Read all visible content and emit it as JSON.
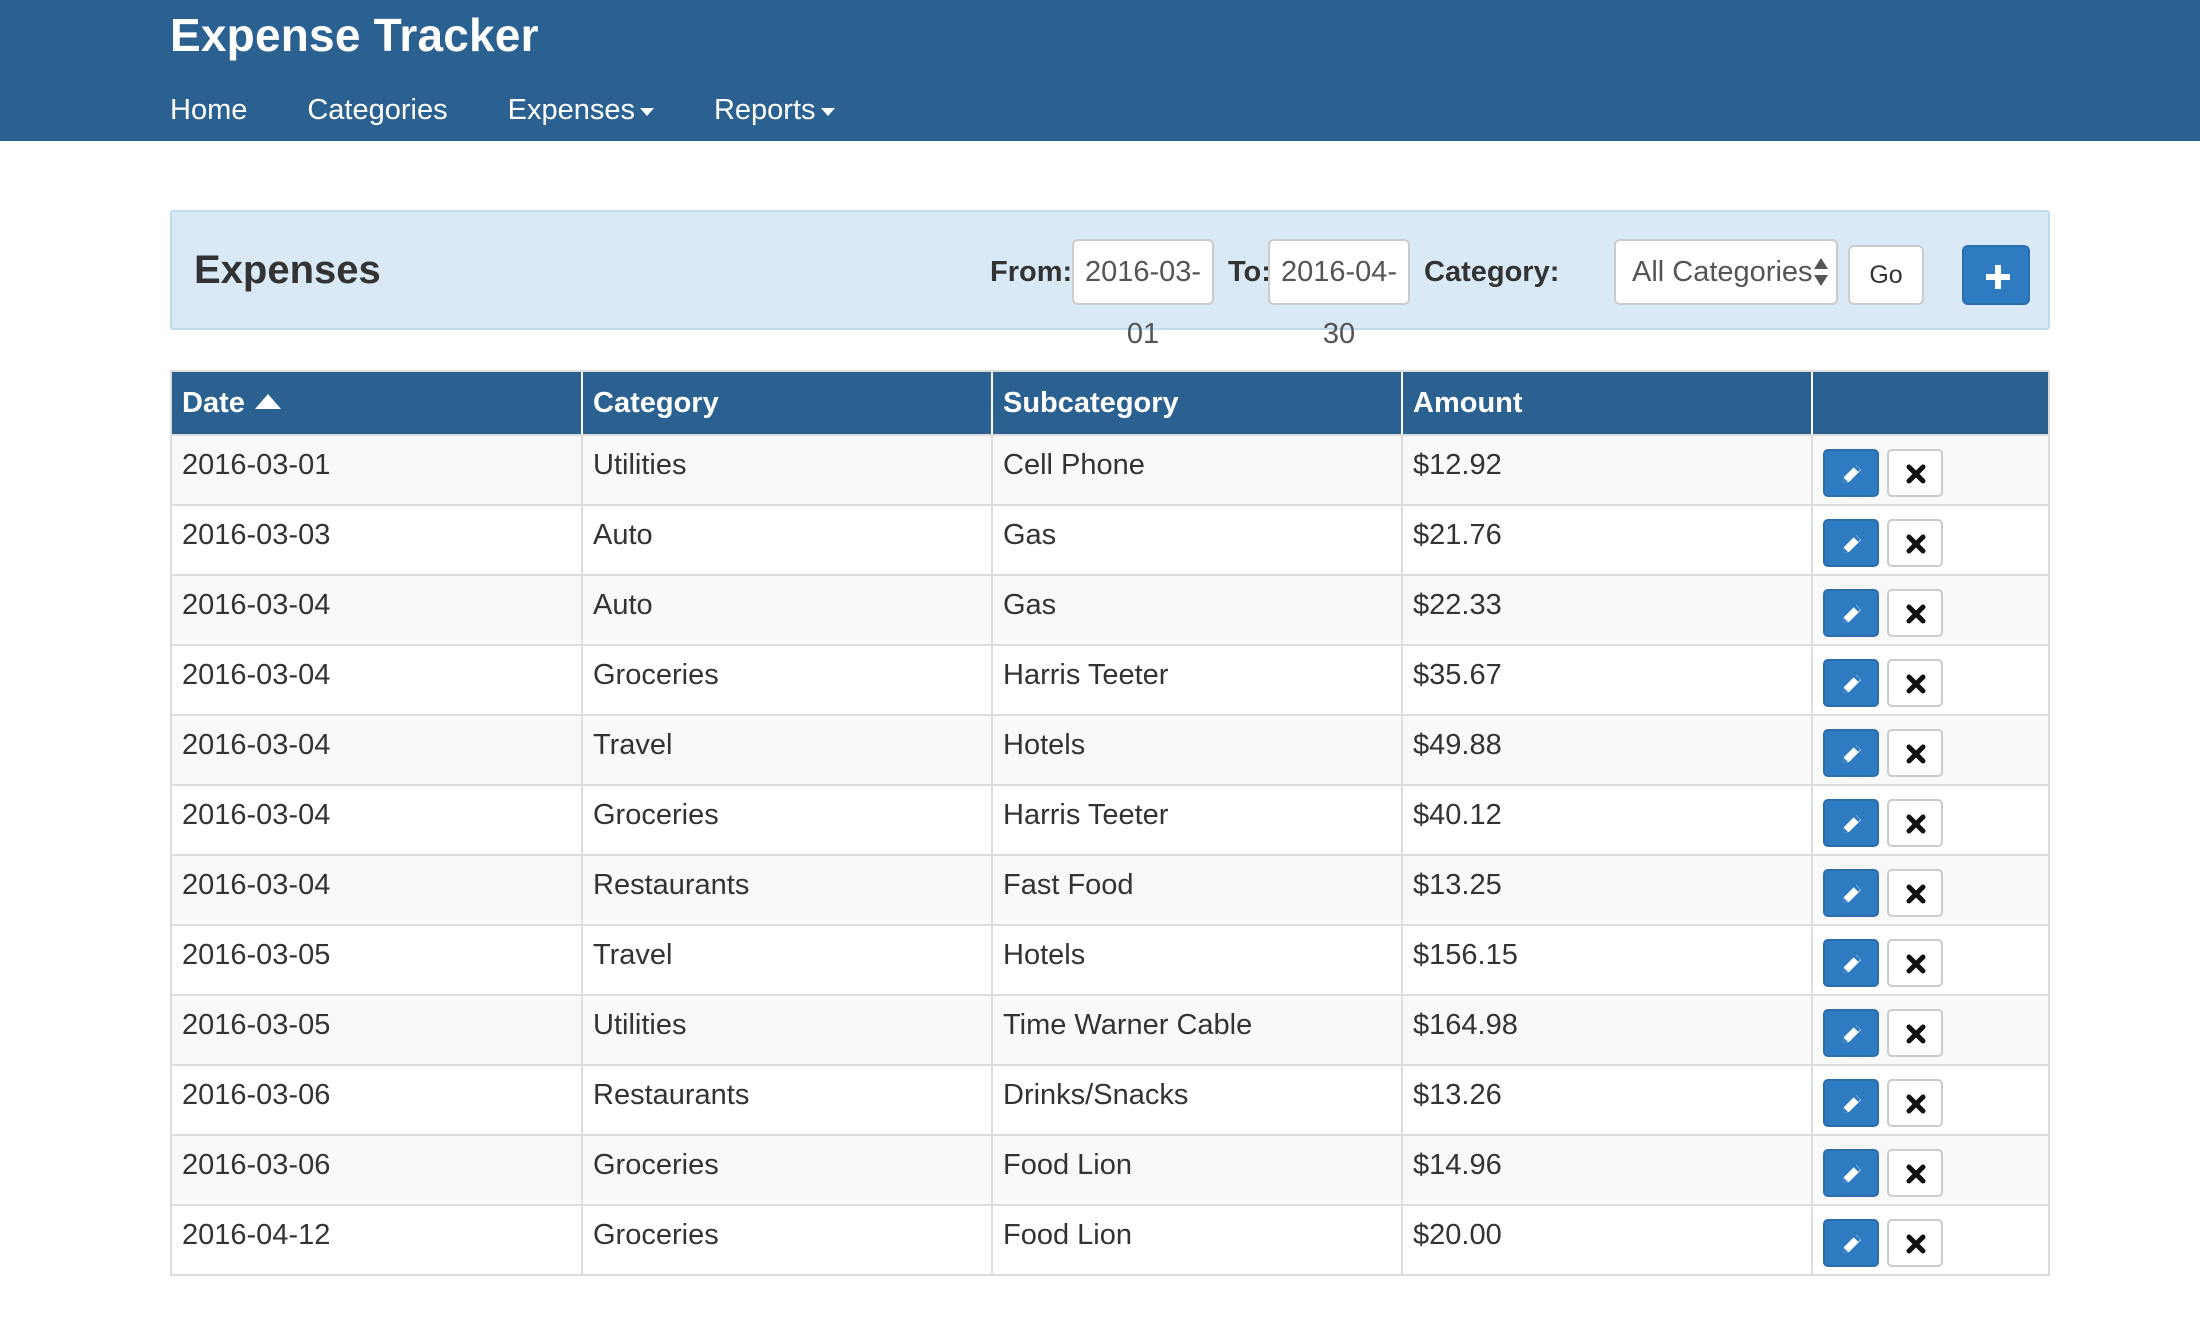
{
  "app": {
    "title": "Expense Tracker"
  },
  "nav": {
    "items": [
      {
        "label": "Home",
        "dropdown": false
      },
      {
        "label": "Categories",
        "dropdown": false
      },
      {
        "label": "Expenses",
        "dropdown": true
      },
      {
        "label": "Reports",
        "dropdown": true
      }
    ]
  },
  "panel": {
    "title": "Expenses",
    "from_label": "From:",
    "from_value": "2016-03-01",
    "to_label": "To:",
    "to_value": "2016-04-30",
    "category_label": "Category:",
    "category_value": "All Categories",
    "go_label": "Go",
    "add_icon": "plus-icon"
  },
  "table": {
    "columns": [
      "Date",
      "Category",
      "Subcategory",
      "Amount",
      ""
    ],
    "sort": {
      "column": "Date",
      "direction": "ascending"
    },
    "rows": [
      {
        "date": "2016-03-01",
        "category": "Utilities",
        "subcategory": "Cell Phone",
        "amount": "$12.92"
      },
      {
        "date": "2016-03-03",
        "category": "Auto",
        "subcategory": "Gas",
        "amount": "$21.76"
      },
      {
        "date": "2016-03-04",
        "category": "Auto",
        "subcategory": "Gas",
        "amount": "$22.33"
      },
      {
        "date": "2016-03-04",
        "category": "Groceries",
        "subcategory": "Harris Teeter",
        "amount": "$35.67"
      },
      {
        "date": "2016-03-04",
        "category": "Travel",
        "subcategory": "Hotels",
        "amount": "$49.88"
      },
      {
        "date": "2016-03-04",
        "category": "Groceries",
        "subcategory": "Harris Teeter",
        "amount": "$40.12"
      },
      {
        "date": "2016-03-04",
        "category": "Restaurants",
        "subcategory": "Fast Food",
        "amount": "$13.25"
      },
      {
        "date": "2016-03-05",
        "category": "Travel",
        "subcategory": "Hotels",
        "amount": "$156.15"
      },
      {
        "date": "2016-03-05",
        "category": "Utilities",
        "subcategory": "Time Warner Cable",
        "amount": "$164.98"
      },
      {
        "date": "2016-03-06",
        "category": "Restaurants",
        "subcategory": "Drinks/Snacks",
        "amount": "$13.26"
      },
      {
        "date": "2016-03-06",
        "category": "Groceries",
        "subcategory": "Food Lion",
        "amount": "$14.96"
      },
      {
        "date": "2016-04-12",
        "category": "Groceries",
        "subcategory": "Food Lion",
        "amount": "$20.00"
      }
    ],
    "row_actions": {
      "edit_icon": "pencil-icon",
      "delete_icon": "close-icon"
    }
  },
  "colors": {
    "navbar": "#2b6190",
    "panel_bg": "#d9eaf6",
    "primary_button": "#2f7bc2",
    "row_stripe": "#f9f9f9"
  }
}
